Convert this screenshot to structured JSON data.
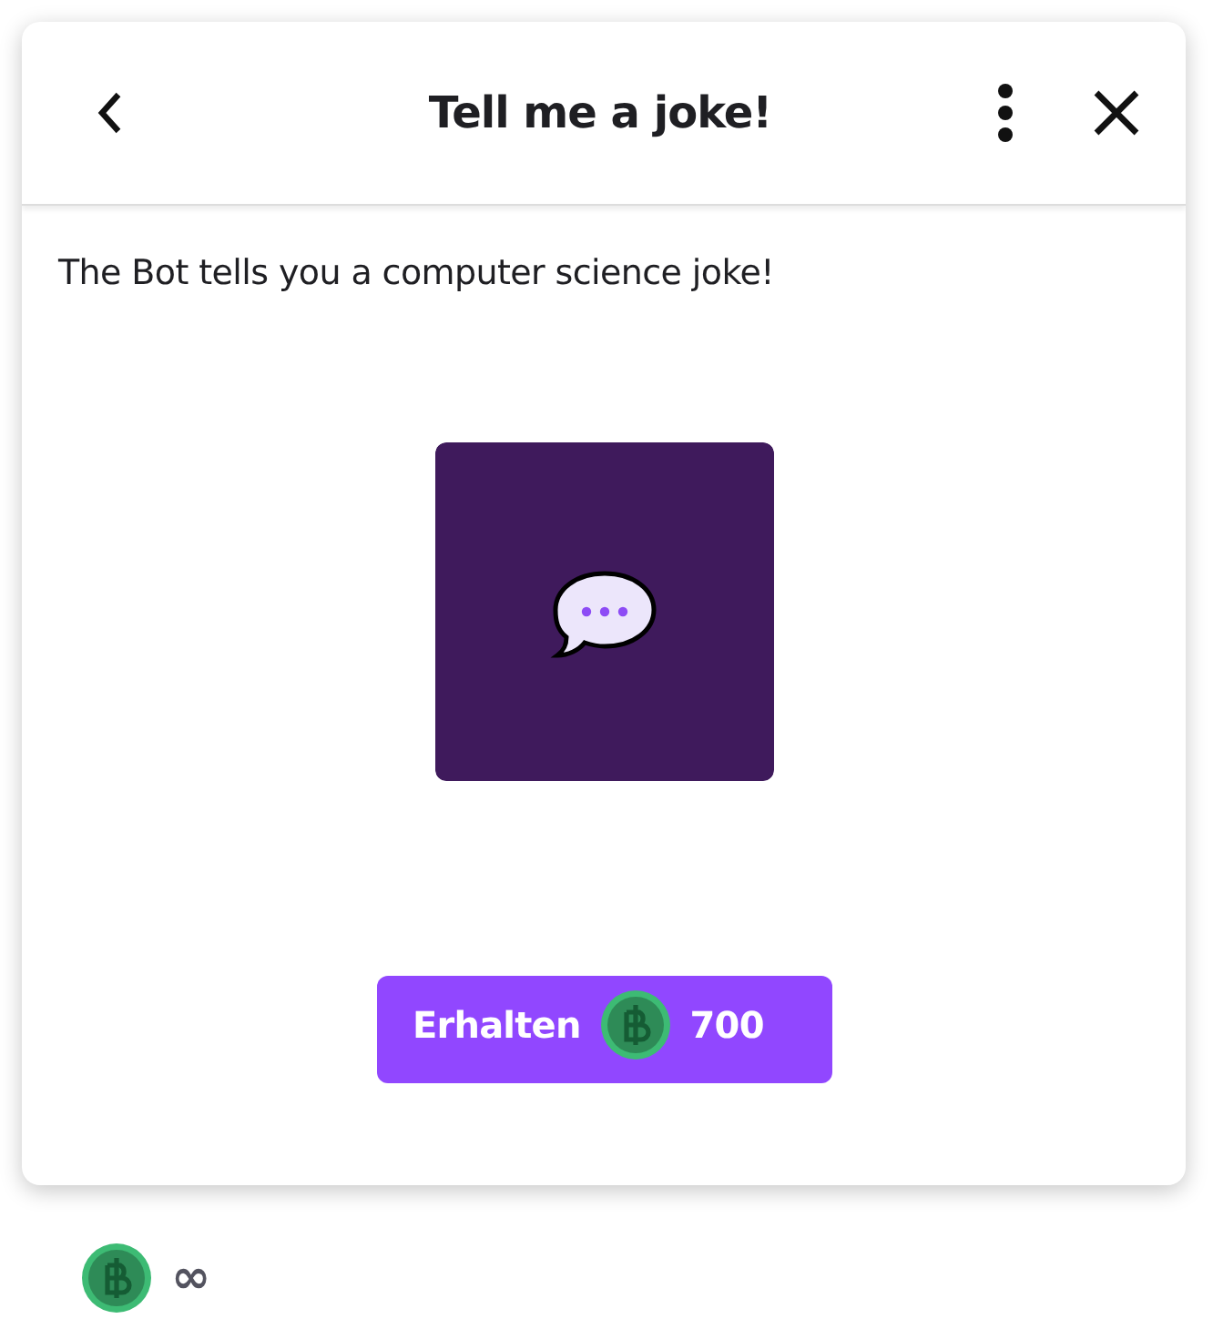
{
  "header": {
    "title": "Tell me a joke!"
  },
  "description": "The Bot tells you a computer science joke!",
  "reward_button": {
    "label": "Erhalten",
    "amount": "700"
  },
  "balance": {
    "amount": "∞"
  }
}
